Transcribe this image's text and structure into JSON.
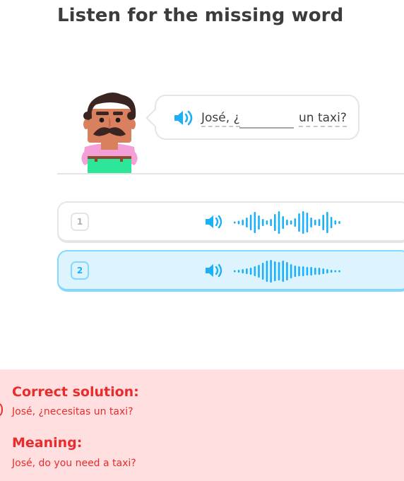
{
  "header": {
    "title": "Listen for the missing word"
  },
  "prompt": {
    "text_before": "José, ¿",
    "text_after": "un taxi?",
    "speaker_icon": "speaker-icon"
  },
  "options": [
    {
      "number": "1",
      "speaker_icon": "speaker-icon",
      "waveform_icon": "audio-waveform-icon",
      "selected": false
    },
    {
      "number": "2",
      "speaker_icon": "speaker-icon",
      "waveform_icon": "audio-waveform-icon",
      "selected": true
    }
  ],
  "feedback": {
    "solution_heading": "Correct solution:",
    "solution_text": "José, ¿necesitas un taxi?",
    "meaning_heading": "Meaning:",
    "meaning_text": "José, do you need a taxi?"
  },
  "colors": {
    "accent_blue": "#1cb0f6",
    "selected_bg": "#ddf4ff",
    "selected_border": "#84d8ff",
    "error_red": "#ea2b2b",
    "error_bg": "#ffdfe0"
  }
}
